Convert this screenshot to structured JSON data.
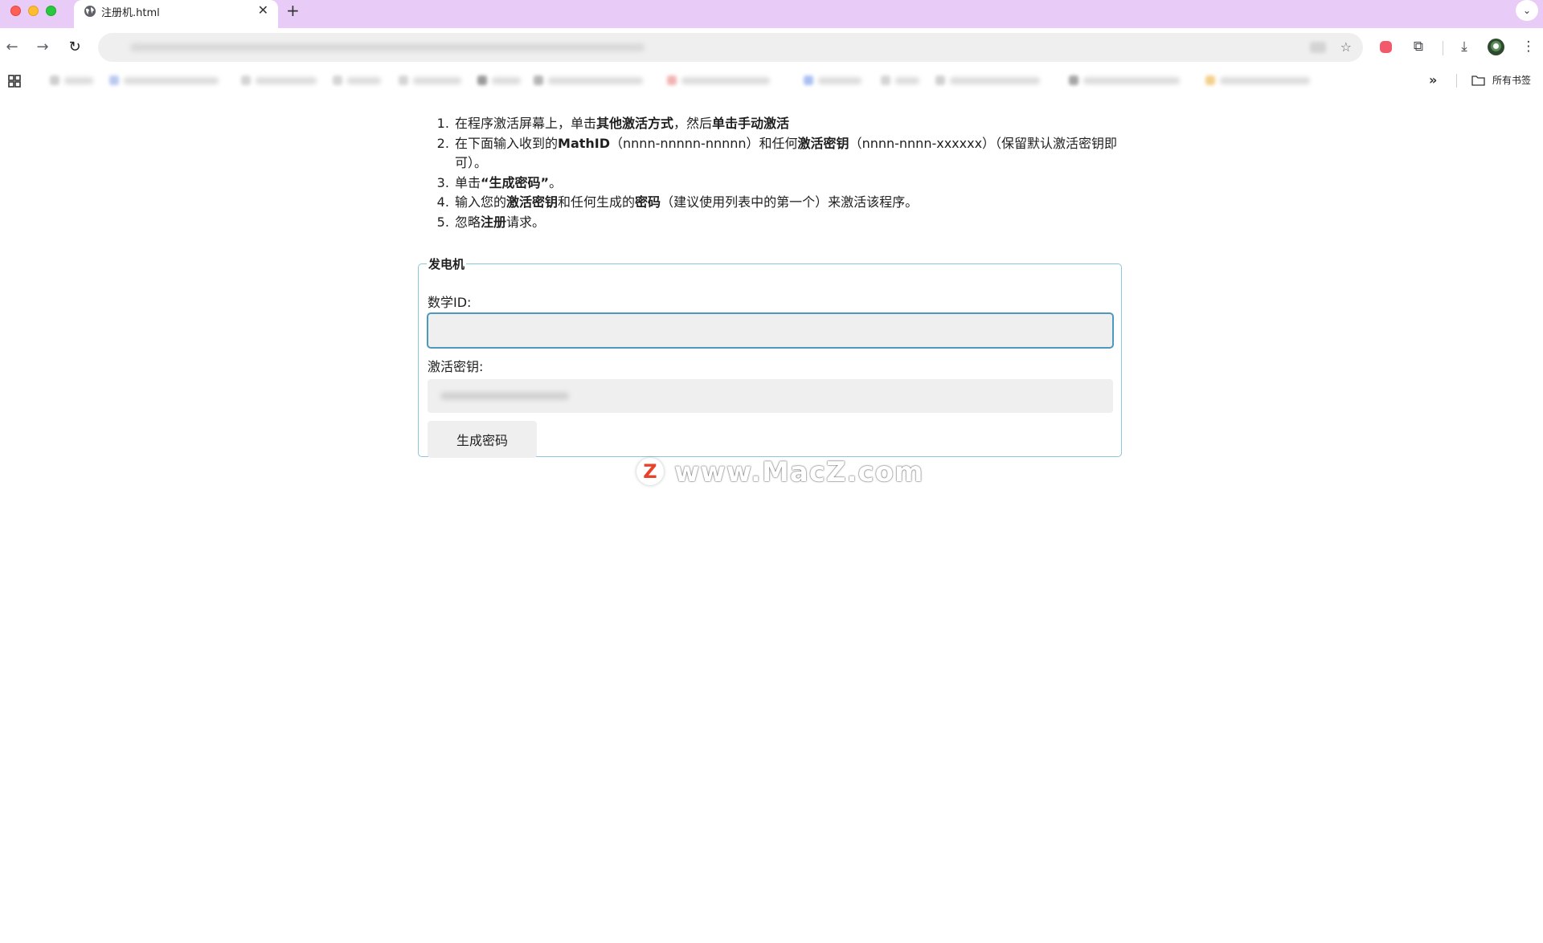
{
  "browser": {
    "tab": {
      "title": "注册机.html",
      "close_glyph": "✕",
      "favicon": "globe-icon"
    },
    "new_tab_glyph": "+",
    "tab_list_glyph": "⌄",
    "toolbar": {
      "back_glyph": "←",
      "forward_glyph": "→",
      "reload_glyph": "↻",
      "download_glyph": "⤓",
      "extensions_glyph": "⧉",
      "menu_glyph": "⋮",
      "star_glyph": "☆"
    },
    "bookmarks": {
      "more_glyph": "»",
      "all_bookmarks_label": "所有书签"
    }
  },
  "instructions": [
    {
      "parts": [
        {
          "t": "在程序激活屏幕上，单击"
        },
        {
          "t": "其他激活方式",
          "b": true
        },
        {
          "t": "，然后"
        },
        {
          "t": "单击手动激活",
          "b": true
        }
      ]
    },
    {
      "parts": [
        {
          "t": "在下面输入收到的"
        },
        {
          "t": "MathID",
          "b": true
        },
        {
          "t": "（nnnn-nnnnn-nnnnn）和任何"
        },
        {
          "t": "激活密钥",
          "b": true
        },
        {
          "t": "（nnnn-nnnn-xxxxxx）（保留默认激活密钥即可）。"
        }
      ]
    },
    {
      "parts": [
        {
          "t": "单击"
        },
        {
          "t": "“生成密码”",
          "b": true
        },
        {
          "t": "。"
        }
      ]
    },
    {
      "parts": [
        {
          "t": "输入您的"
        },
        {
          "t": "激活密钥",
          "b": true
        },
        {
          "t": "和任何生成的"
        },
        {
          "t": "密码",
          "b": true
        },
        {
          "t": "（建议使用列表中的第一个）来激活该程序。"
        }
      ]
    },
    {
      "parts": [
        {
          "t": "忽略"
        },
        {
          "t": "注册",
          "b": true
        },
        {
          "t": "请求。"
        }
      ]
    }
  ],
  "generator": {
    "legend": "发电机",
    "mathid_label": "数学ID:",
    "mathid_value": "",
    "activation_key_label": "激活密钥:",
    "generate_button_label": "生成密码"
  },
  "watermark": {
    "logo_letter": "Z",
    "text": "www.MacZ.com"
  }
}
